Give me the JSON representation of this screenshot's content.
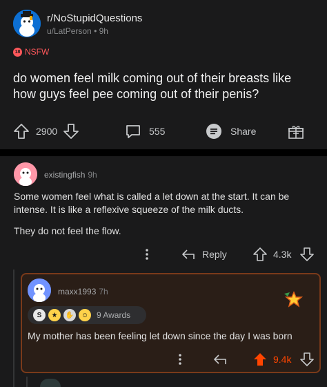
{
  "post": {
    "subreddit": "r/NoStupidQuestions",
    "author": "u/LatPerson",
    "age": "9h",
    "nsfw_badge": "18",
    "nsfw_label": "NSFW",
    "title": "do women feel milk coming out of their breasts like how guys feel pee coming out of their penis?",
    "votes": "2900",
    "comments": "555",
    "share_label": "Share"
  },
  "comment": {
    "author": "existingfish",
    "age": "9h",
    "body_p1": "Some women feel what is called a let down at the start. It can be intense. It is like a reflexive squeeze of the milk ducts.",
    "body_p2": "They do not feel the flow.",
    "reply_label": "Reply",
    "votes": "4.3k"
  },
  "reply": {
    "author": "maxx1993",
    "age": "7h",
    "awards_count": "9 Awards",
    "body": "My mother has been feeling let down since the day I was born",
    "votes": "9.4k",
    "upvote_color": "#ff4500"
  },
  "icons": [
    "subreddit-avatar-icon",
    "upvote-icon",
    "downvote-icon",
    "comment-icon",
    "share-icon",
    "award-icon",
    "more-icon",
    "reply-icon",
    "star-award-icon"
  ]
}
